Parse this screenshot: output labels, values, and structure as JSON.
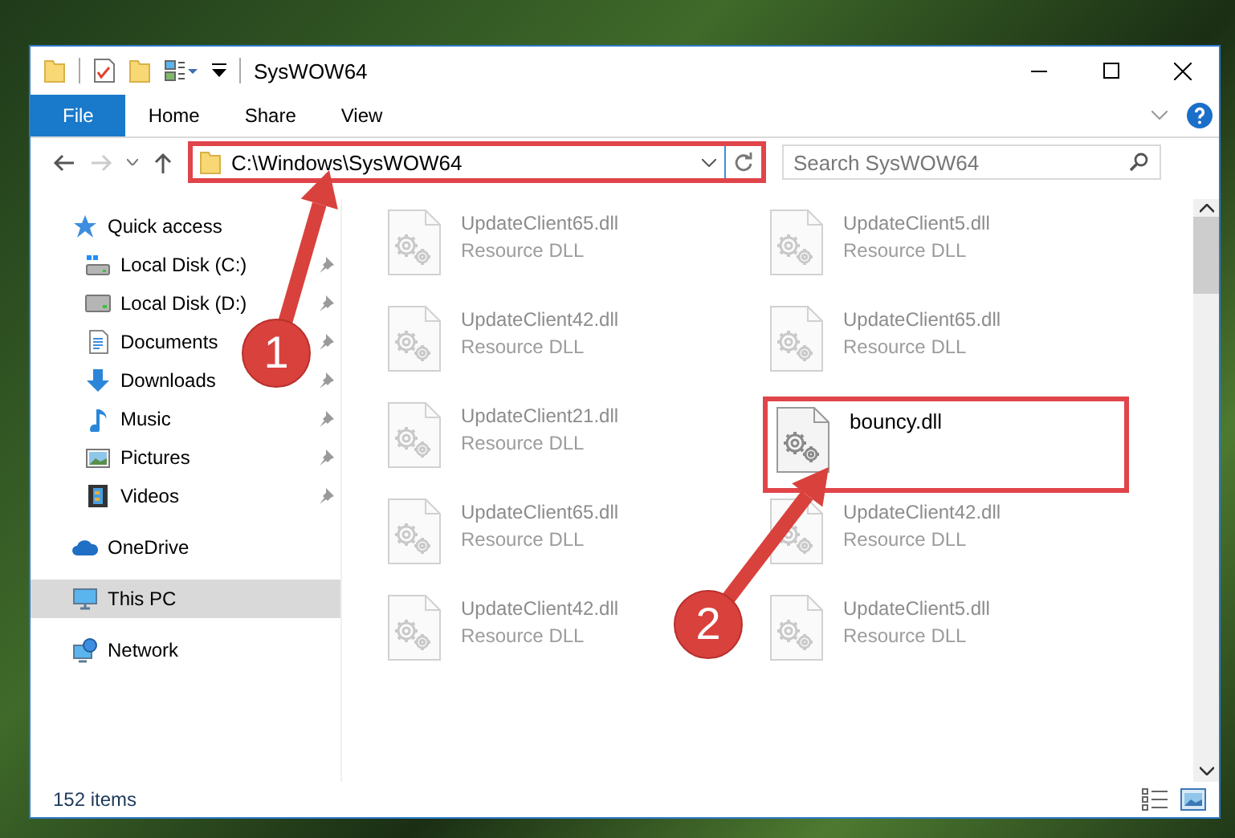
{
  "window": {
    "title": "SysWOW64"
  },
  "ribbon_tabs": [
    {
      "label": "File",
      "kind": "file"
    },
    {
      "label": "Home",
      "kind": "tab"
    },
    {
      "label": "Share",
      "kind": "tab"
    },
    {
      "label": "View",
      "kind": "tab"
    }
  ],
  "address": {
    "path": "C:\\Windows\\SysWOW64",
    "highlighted": true,
    "callout": "1"
  },
  "search": {
    "placeholder": "Search SysWOW64"
  },
  "sidebar": {
    "items": [
      {
        "label": "Quick access",
        "kind": "star",
        "selected": false,
        "children": [
          {
            "label": "Local Disk (C:)",
            "kind": "drive-windows",
            "pinned": true,
            "selected": false
          },
          {
            "label": "Local Disk (D:)",
            "kind": "drive",
            "pinned": true,
            "selected": false
          },
          {
            "label": "Documents",
            "kind": "documents",
            "pinned": true,
            "selected": false
          },
          {
            "label": "Downloads",
            "kind": "downloads",
            "pinned": true,
            "selected": false
          },
          {
            "label": "Music",
            "kind": "music",
            "pinned": true,
            "selected": false
          },
          {
            "label": "Pictures",
            "kind": "pictures",
            "pinned": true,
            "selected": false
          },
          {
            "label": "Videos",
            "kind": "videos",
            "pinned": true,
            "selected": false
          }
        ]
      },
      {
        "label": "OneDrive",
        "kind": "cloud",
        "selected": false
      },
      {
        "label": "This PC",
        "kind": "pc",
        "selected": true
      },
      {
        "label": "Network",
        "kind": "network",
        "selected": false
      }
    ]
  },
  "files": [
    {
      "name": "UpdateClient65.dll",
      "type": "Resource DLL",
      "highlighted": false
    },
    {
      "name": "UpdateClient42.dll",
      "type": "Resource DLL",
      "highlighted": false
    },
    {
      "name": "UpdateClient21.dll",
      "type": "Resource DLL",
      "highlighted": false
    },
    {
      "name": "UpdateClient65.dll",
      "type": "Resource DLL",
      "highlighted": false
    },
    {
      "name": "UpdateClient42.dll",
      "type": "Resource DLL",
      "highlighted": false
    },
    {
      "name": "UpdateClient5.dll",
      "type": "Resource DLL",
      "highlighted": false
    },
    {
      "name": "UpdateClient65.dll",
      "type": "Resource DLL",
      "highlighted": false
    },
    {
      "name": "bouncy.dll",
      "highlighted": true,
      "callout": "2"
    },
    {
      "name": "UpdateClient42.dll",
      "type": "Resource DLL",
      "highlighted": false
    },
    {
      "name": "UpdateClient5.dll",
      "type": "Resource DLL",
      "highlighted": false
    }
  ],
  "status_bar": {
    "item_count": "152 items"
  }
}
